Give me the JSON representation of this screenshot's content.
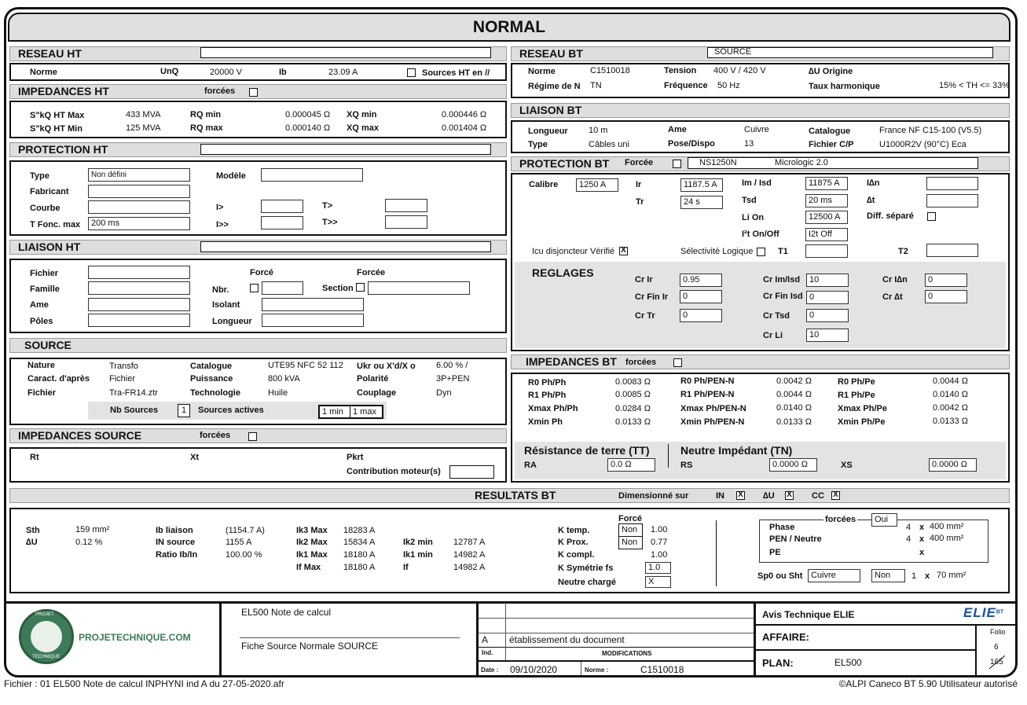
{
  "title": "NORMAL",
  "reseau_ht": {
    "header": "RESEAU HT",
    "norme_label": "Norme",
    "unq_label": "UnQ",
    "unq": "20000 V",
    "ib_label": "Ib",
    "ib": "23.09 A",
    "sources_label": "Sources HT en //"
  },
  "imp_ht": {
    "header": "IMPEDANCES HT",
    "forcees": "forcées",
    "r1": [
      "S\"kQ HT Max",
      "433 MVA",
      "RQ min",
      "0.000045 Ω",
      "XQ min",
      "0.000446 Ω"
    ],
    "r2": [
      "S\"kQ HT Min",
      "125 MVA",
      "RQ max",
      "0.000140 Ω",
      "XQ max",
      "0.001404 Ω"
    ]
  },
  "prot_ht": {
    "header": "PROTECTION HT",
    "type": "Type",
    "type_val": "Non défini",
    "modele": "Modèle",
    "fabricant": "Fabricant",
    "courbe": "Courbe",
    "tfonc": "T Fonc. max",
    "tfonc_val": "200 ms",
    "i1": "I>",
    "i2": "I>>",
    "t1": "T>",
    "t2": "T>>"
  },
  "liaison_ht": {
    "header": "LIAISON HT",
    "fichier": "Fichier",
    "famille": "Famille",
    "ame": "Ame",
    "poles": "Pôles",
    "force": "Forcé",
    "forcee": "Forcée",
    "nbr": "Nbr.",
    "section": "Section",
    "isolant": "Isolant",
    "longueur": "Longueur"
  },
  "source": {
    "header": "SOURCE",
    "nature": "Nature",
    "nature_val": "Transfo",
    "caract": "Caract. d'après",
    "caract_val": "Fichier",
    "fichier": "Fichier",
    "fichier_val": "Tra-FR14.ztr",
    "catalogue": "Catalogue",
    "catalogue_val": "UTE95 NFC 52 112",
    "puissance": "Puissance",
    "puissance_val": "800 kVA",
    "techno": "Technologie",
    "techno_val": "Huile",
    "ukr": "Ukr ou X'd/X o",
    "ukr_val": "6.00 %  /",
    "polarite": "Polarité",
    "polarite_val": "3P+PEN",
    "couplage": "Couplage",
    "couplage_val": "Dyn",
    "nb_sources": "Nb Sources",
    "nb_val": "1",
    "actives": "Sources actives",
    "min": "1 min",
    "max": "1 max"
  },
  "imp_source": {
    "header": "IMPEDANCES SOURCE",
    "forcees": "forcées",
    "rt": "Rt",
    "xt": "Xt",
    "pkrt": "Pkrt",
    "contrib": "Contribution moteur(s)"
  },
  "reseau_bt": {
    "header": "RESEAU BT",
    "source": "SOURCE",
    "norme": "Norme",
    "norme_val": "C1510018",
    "regime": "Régime de N",
    "regime_val": "TN",
    "tension": "Tension",
    "tension_val": "400 V   /    420 V",
    "freq": "Fréquence",
    "freq_val": "50 Hz",
    "du": "∆U Origine",
    "taux": "Taux harmonique",
    "taux_val": "15% < TH <= 33%"
  },
  "liaison_bt": {
    "header": "LIAISON BT",
    "longueur": "Longueur",
    "longueur_val": "10 m",
    "type": "Type",
    "type_val": "Câbles uni",
    "ame": "Ame",
    "ame_val": "Cuivre",
    "pose": "Pose/Dispo",
    "pose_val": "13",
    "catalogue": "Catalogue",
    "catalogue_val": "France NF C15-100 (V5.5)",
    "fichier": "Fichier C/P",
    "fichier_val": "U1000R2V (90°C) Eca"
  },
  "prot_bt": {
    "header": "PROTECTION BT",
    "forcee": "Forcée",
    "disj": "NS1250N",
    "micro": "Micrologic 2.0",
    "calibre": "Calibre",
    "calibre_val": "1250 A",
    "ir": "Ir",
    "ir_val": "1187.5 A",
    "tr": "Tr",
    "tr_val": "24 s",
    "im": "Im / Isd",
    "im_val": "11875 A",
    "tsd": "Tsd",
    "tsd_val": "20 ms",
    "li": "Li  On",
    "li_val": "12500 A",
    "i2t": "I²t On/Off",
    "i2t_val": "I2t Off",
    "idn": "I∆n",
    "dt": "∆t",
    "diff": "Diff. séparé",
    "icu": "Icu disjoncteur Vérifié",
    "sel": "Sélectivité Logique",
    "t1": "T1",
    "t2": "T2",
    "reglages": "REGLAGES",
    "crir": "Cr Ir",
    "crir_val": "0.95",
    "crfinir": "Cr Fin Ir",
    "crfinir_val": "0",
    "crtr": "Cr Tr",
    "crtr_val": "0",
    "crim": "Cr Im/Isd",
    "crim_val": "10",
    "crfinisd": "Cr Fin Isd",
    "crfinisd_val": "0",
    "crtsd": "Cr Tsd",
    "crtsd_val": "0",
    "crli": "Cr Li",
    "crli_val": "10",
    "cridn": "Cr I∆n",
    "cridn_val": "0",
    "crdt": "Cr ∆t",
    "crdt_val": "0"
  },
  "imp_bt": {
    "header": "IMPEDANCES BT",
    "forcees": "forcées",
    "c1": [
      [
        "R0 Ph/Ph",
        "0.0083 Ω"
      ],
      [
        "R1 Ph/Ph",
        "0.0085 Ω"
      ],
      [
        "Xmax Ph/Ph",
        "0.0284 Ω"
      ],
      [
        "Xmin Ph",
        "0.0133 Ω"
      ]
    ],
    "c2": [
      [
        "R0 Ph/PEN-N",
        "0.0042 Ω"
      ],
      [
        "R1 Ph/PEN-N",
        "0.0044 Ω"
      ],
      [
        "Xmax Ph/PEN-N",
        "0.0140 Ω"
      ],
      [
        "Xmin Ph/PEN-N",
        "0.0133 Ω"
      ]
    ],
    "c3": [
      [
        "R0 Ph/Pe",
        "0.0044 Ω"
      ],
      [
        "R1 Ph/Pe",
        "0.0140 Ω"
      ],
      [
        "Xmax Ph/Pe",
        "0.0042 Ω"
      ],
      [
        "Xmin Ph/Pe",
        "0.0133 Ω"
      ]
    ],
    "tt": "Résistance de terre (TT)",
    "tn": "Neutre Impédant (TN)",
    "ra": "RA",
    "ra_val": "0.0 Ω",
    "rs": "RS",
    "rs_val": "0.0000 Ω",
    "xs": "XS",
    "xs_val": "0.0000 Ω"
  },
  "resultats": {
    "header": "RESULTATS BT",
    "dim": "Dimensionné sur",
    "in": "IN",
    "du": "∆U",
    "cc": "CC",
    "sth": "Sth",
    "sth_val": "159 mm²",
    "du_val": "0.12 %",
    "ibl": "Ib liaison",
    "ibl_val": "(1154.7 A)",
    "ins": "IN source",
    "ins_val": "1155 A",
    "ratio": "Ratio Ib/In",
    "ratio_val": "100.00 %",
    "ik3": "Ik3 Max",
    "ik3_val": "18283 A",
    "ik2": "Ik2 Max",
    "ik2_val": "15834 A",
    "ik1": "Ik1 Max",
    "ik1_val": "18180 A",
    "ifm": "If Max",
    "ifm_val": "18180 A",
    "ik2min": "Ik2 min",
    "ik2min_val": "12787 A",
    "ik1min": "Ik1 min",
    "ik1min_val": "14982 A",
    "if": "If",
    "if_val": "14982 A",
    "force": "Forcé",
    "ktemp": "K temp.",
    "ktemp_f": "Non",
    "ktemp_val": "1.00",
    "kprox": "K Prox.",
    "kprox_f": "Non",
    "kprox_val": "0.77",
    "kcompl": "K compl.",
    "kcompl_val": "1.00",
    "ksym": "K Symétrie fs",
    "ksym_val": "1.0",
    "neutre": "Neutre chargé",
    "neutre_val": "X",
    "forcees": "forcées",
    "oui": "Oui",
    "phase": "Phase",
    "phase_n": "4",
    "phase_s": "400 mm²",
    "pen": "PEN / Neutre",
    "pen_n": "4",
    "pen_s": "400 mm²",
    "pe": "PE",
    "x": "x",
    "sp0": "Sp0 ou Sht",
    "sp0_mat": "Cuivre",
    "sp0_non": "Non",
    "sp0_n": "1",
    "sp0_s": "70 mm²"
  },
  "cartouche": {
    "logo_text": "PROJETECHNIQUE.COM",
    "logo_top": "PROJET",
    "logo_bottom": "TECHNIQUE",
    "doc1": "EL500 Note de calcul",
    "doc2": "Fiche Source Normale SOURCE",
    "ind_a": "A",
    "etab": "établissement du document",
    "ind": "Ind.",
    "modifs": "MODIFICATIONS",
    "date_lbl": "Date :",
    "date": "09/10/2020",
    "norme_lbl": "Norme :",
    "norme": "C1510018",
    "avis": "Avis Technique ELIE",
    "affaire": "AFFAIRE:",
    "plan": "PLAN:",
    "plan_val": "EL500",
    "folio": "Folio",
    "folio_n": "6",
    "folio_t": "165",
    "elie": "ELIE",
    "bt": "BT"
  },
  "footer": {
    "left": "Fichier : 01 EL500 Note de calcul INPHYNI ind A du 27-05-2020.afr",
    "right": "©ALPI Caneco BT 5.90 Utilisateur autorisé"
  }
}
